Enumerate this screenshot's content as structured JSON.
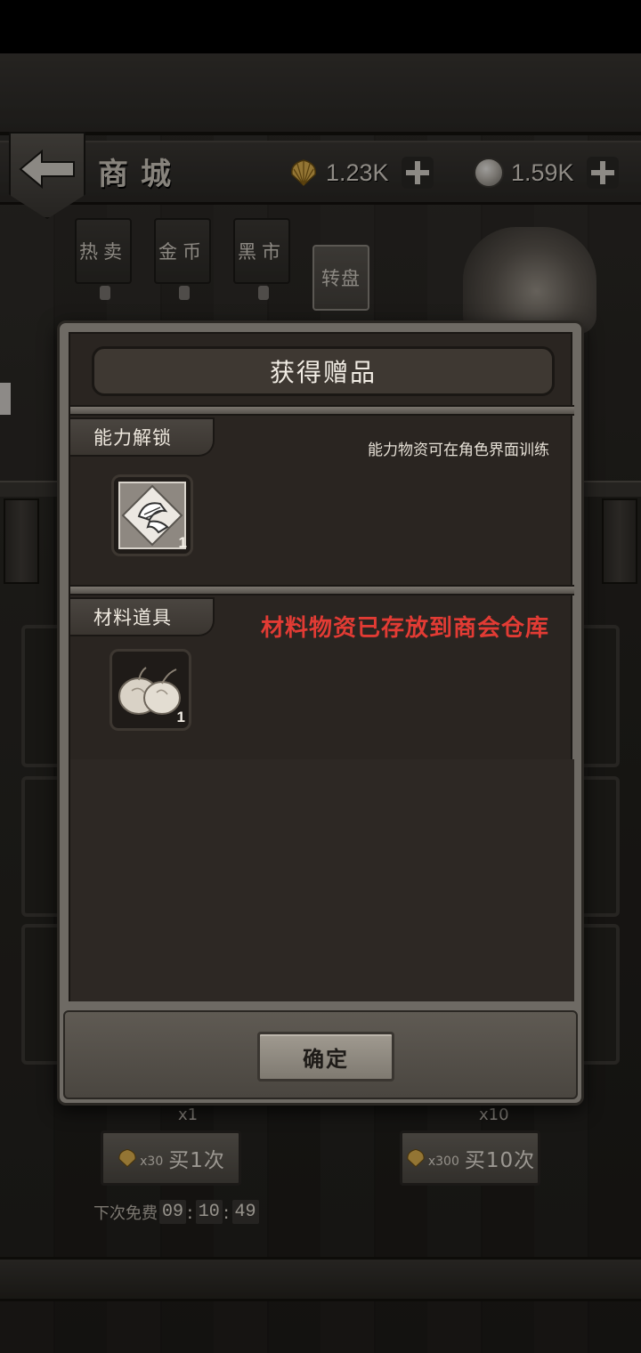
{
  "header": {
    "title": "商城",
    "shells": "1.23K",
    "coins": "1.59K"
  },
  "tabs": [
    "热卖",
    "金币",
    "黑市",
    "转盘"
  ],
  "active_tab": "转盘",
  "modal": {
    "title": "获得赠品",
    "sections": [
      {
        "label": "能力解锁",
        "note": "能力物资可在角色界面训练",
        "item_icon": "ability-scroll-icon",
        "count": "1"
      },
      {
        "label": "材料道具",
        "note": "材料物资已存放到商会仓库",
        "item_icon": "garlic-icon",
        "count": "1"
      }
    ],
    "confirm_label": "确定"
  },
  "background": {
    "reward_left": "x1",
    "reward_right": "x10",
    "buy_one": {
      "cost": "x30",
      "label": "买1次"
    },
    "buy_ten": {
      "cost": "x300",
      "label": "买10次"
    },
    "free_label": "下次免费",
    "timer": [
      "09",
      "10",
      "49"
    ]
  },
  "colors": {
    "note_red": "#e23b34",
    "panel_dark": "#2a2521",
    "frame": "#6e6a64"
  }
}
